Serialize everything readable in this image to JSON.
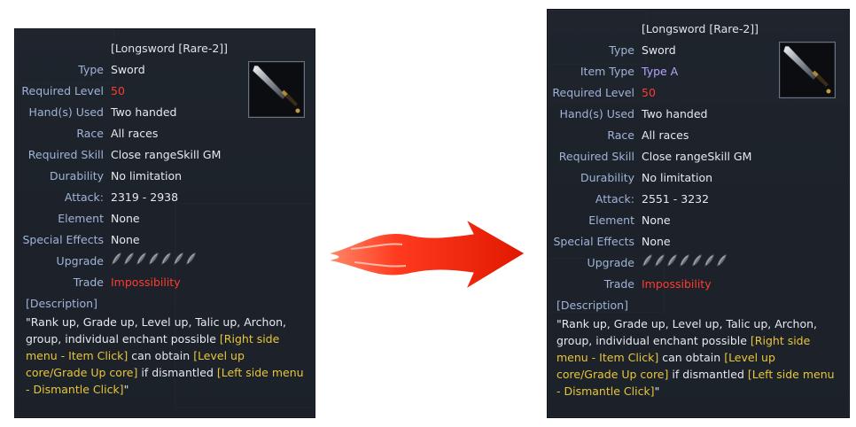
{
  "left": {
    "title": "[Longsword [Rare-2]]",
    "stats": [
      {
        "label": "Type",
        "value": "Sword",
        "color": "white"
      },
      {
        "label": "Required Level",
        "value": "50",
        "color": "red"
      },
      {
        "label": "Hand(s) Used",
        "value": "Two handed",
        "color": "white"
      },
      {
        "label": "Race",
        "value": "All races",
        "color": "white"
      },
      {
        "label": "Required Skill",
        "value": "Close rangeSkill GM",
        "color": "white"
      },
      {
        "label": "Durability",
        "value": "No limitation",
        "color": "white"
      },
      {
        "label": "Attack:",
        "value": "2319 - 2938",
        "color": "white"
      },
      {
        "label": "Element",
        "value": "None",
        "color": "white"
      },
      {
        "label": "Special Effects",
        "value": "None",
        "color": "white"
      },
      {
        "label": "Upgrade",
        "value": "",
        "color": "white"
      },
      {
        "label": "Trade",
        "value": "Impossibility",
        "color": "red"
      }
    ],
    "upgrade_slots": 7,
    "description_header": "[Description]",
    "description": [
      {
        "text": "\"Rank up, Grade up, Level up, Talic up, Archon, group, individual enchant possible",
        "color": "white"
      },
      {
        "text": " ",
        "color": "white"
      },
      {
        "text": "[Right side menu - Item Click]",
        "color": "yellow"
      },
      {
        "text": " can obtain ",
        "color": "white"
      },
      {
        "text": "[Level up core/Grade Up core]",
        "color": "yellow"
      },
      {
        "text": " if dismantled ",
        "color": "white"
      },
      {
        "text": "[Left side menu - Dismantle Click]",
        "color": "yellow"
      },
      {
        "text": "\"",
        "color": "white"
      }
    ]
  },
  "right": {
    "title": "[Longsword [Rare-2]]",
    "stats": [
      {
        "label": "Type",
        "value": "Sword",
        "color": "white"
      },
      {
        "label": "Item Type",
        "value": "Type A",
        "color": "purple"
      },
      {
        "label": "Required Level",
        "value": "50",
        "color": "red"
      },
      {
        "label": "Hand(s) Used",
        "value": "Two handed",
        "color": "white"
      },
      {
        "label": "Race",
        "value": "All races",
        "color": "white"
      },
      {
        "label": "Required Skill",
        "value": "Close rangeSkill GM",
        "color": "white"
      },
      {
        "label": "Durability",
        "value": "No limitation",
        "color": "white"
      },
      {
        "label": "Attack:",
        "value": "2551 - 3232",
        "color": "white"
      },
      {
        "label": "Element",
        "value": "None",
        "color": "white"
      },
      {
        "label": "Special Effects",
        "value": "None",
        "color": "white"
      },
      {
        "label": "Upgrade",
        "value": "",
        "color": "white"
      },
      {
        "label": "Trade",
        "value": "Impossibility",
        "color": "red"
      }
    ],
    "upgrade_slots": 7,
    "description_header": "[Description]",
    "description": [
      {
        "text": "\"Rank up, Grade up, Level up, Talic up, Archon, group, individual enchant possible",
        "color": "white"
      },
      {
        "text": " ",
        "color": "white"
      },
      {
        "text": "[Right side menu - Item Click]",
        "color": "yellow"
      },
      {
        "text": " can obtain ",
        "color": "white"
      },
      {
        "text": "[Level up core/Grade Up core]",
        "color": "yellow"
      },
      {
        "text": " if dismantled ",
        "color": "white"
      },
      {
        "text": "[Left side menu - Dismantle Click]",
        "color": "yellow"
      },
      {
        "text": "\"",
        "color": "white"
      }
    ]
  },
  "icons": {
    "item": "longsword-icon",
    "upgrade_slot": "upgrade-slot-icon",
    "arrow": "right-arrow-icon"
  },
  "colors": {
    "label": "#9fb4d8",
    "value": "#e6e9ed",
    "red": "#ff3b2f",
    "purple": "#b7a2ff",
    "yellow": "#e8c53a",
    "arrow": "#ff3a1f"
  }
}
